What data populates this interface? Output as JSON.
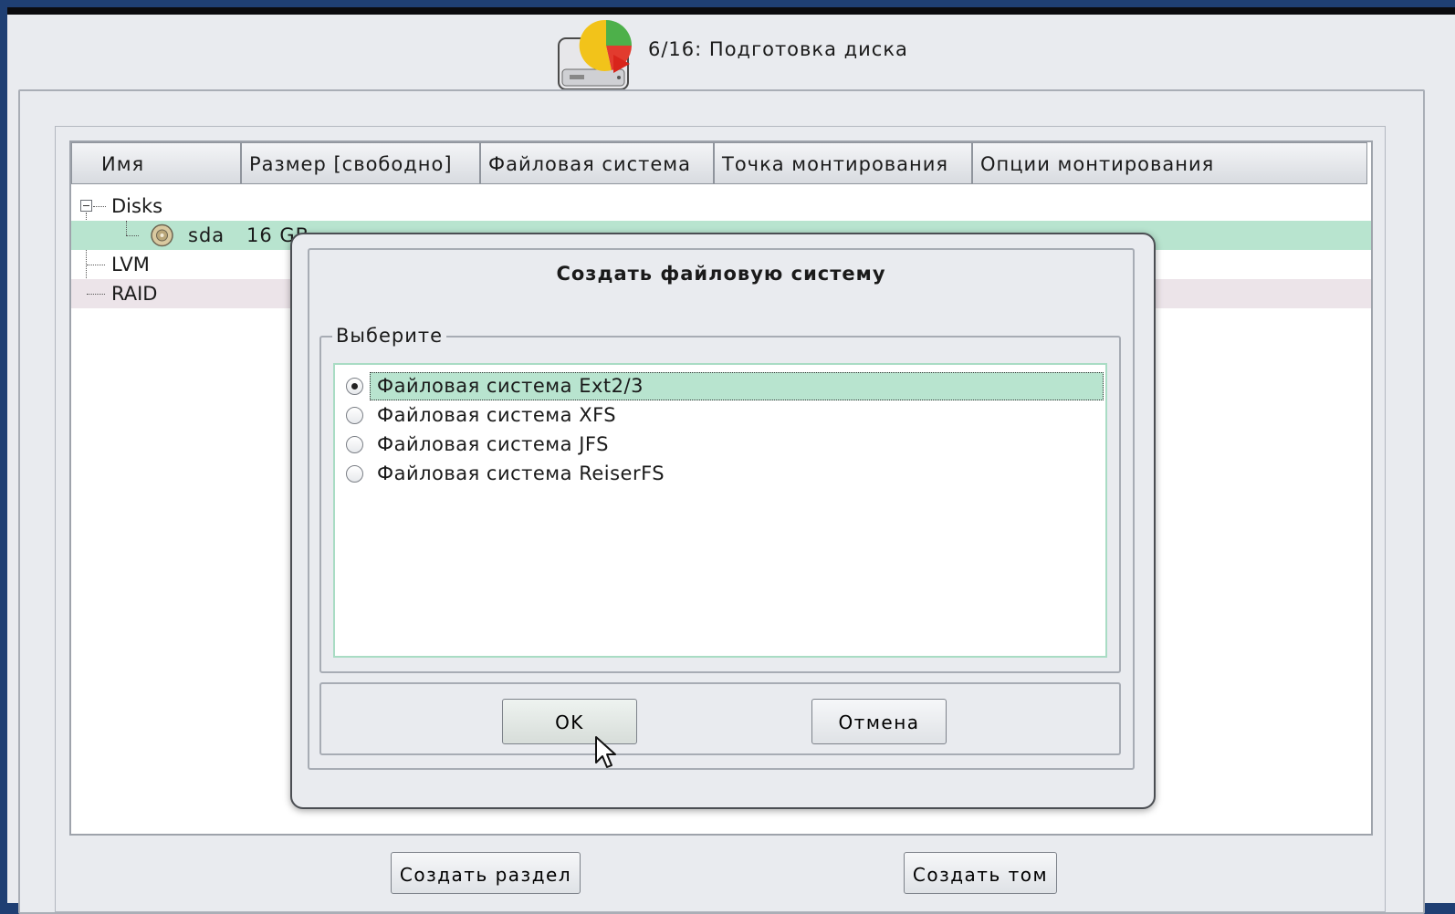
{
  "header": {
    "title": "6/16: Подготовка диска",
    "icon": "disk-partition-icon"
  },
  "tree": {
    "columns": [
      "Имя",
      "Размер [свободно]",
      "Файловая система",
      "Точка монтирования",
      "Опции монтирования"
    ],
    "rows": [
      {
        "name": "Disks"
      },
      {
        "name": "sda",
        "size": "16 GB",
        "icon": "hard-disk-icon"
      },
      {
        "name": "LVM"
      },
      {
        "name": "RAID"
      }
    ]
  },
  "buttons": {
    "create_partition": "Создать раздел",
    "create_volume": "Создать том"
  },
  "dialog": {
    "title": "Создать файловую систему",
    "group_label": "Выберите",
    "options": [
      {
        "label": "Файловая система Ext2/3",
        "selected": true
      },
      {
        "label": "Файловая система XFS",
        "selected": false
      },
      {
        "label": "Файловая система JFS",
        "selected": false
      },
      {
        "label": "Файловая система ReiserFS",
        "selected": false
      }
    ],
    "ok_label": "OK",
    "cancel_label": "Отмена"
  },
  "colors": {
    "selection": "#b8e4cf",
    "window_bg": "#e9ebef",
    "desktop": "#1f3f73"
  }
}
